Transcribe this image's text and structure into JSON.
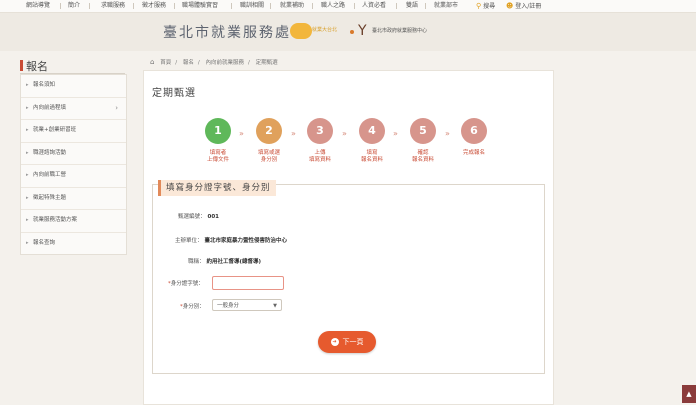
{
  "topnav": {
    "items": [
      "網站導覽",
      "簡介",
      "求職服務",
      "徵才服務",
      "職場體驗實習",
      "職訓相關",
      "就業補助",
      "職人之路",
      "人資必看",
      "雙語",
      "就業部市"
    ],
    "search_label": "搜尋",
    "login_label": "登入/註冊"
  },
  "banner": {
    "title": "臺北市就業服務處",
    "logo1_text": "就業大台北",
    "logo2_text": "臺北市政府就業服務中心"
  },
  "sidebar": {
    "heading": "報名",
    "items": [
      "報名須知",
      "內向前過程填",
      "就業+創業研習班",
      "職涯諮詢活動",
      "內向前職工營",
      "徵起特殊主題",
      "就業服務活動方案",
      "報名查詢"
    ]
  },
  "breadcrumb": [
    "首頁",
    "報名",
    "內向前就業服務",
    "定期甄選"
  ],
  "page": {
    "title": "定期甄選"
  },
  "steps": [
    {
      "num": "1",
      "label": "填寫者\n上傳文件",
      "color": "#5fb85a"
    },
    {
      "num": "2",
      "label": "填寫或選\n身分別",
      "color": "#e0a15c"
    },
    {
      "num": "3",
      "label": "上傳\n填寫資料",
      "color": "#d7958c"
    },
    {
      "num": "4",
      "label": "填寫\n報名資料",
      "color": "#d7958c"
    },
    {
      "num": "5",
      "label": "確認\n報名資料",
      "color": "#d7958c"
    },
    {
      "num": "6",
      "label": "完成報名",
      "color": "#d7958c"
    }
  ],
  "form": {
    "section_title": "填寫身分證字號、身分別",
    "rows": [
      {
        "label": "甄選編號：",
        "value": "001"
      },
      {
        "label": "主辦單位：",
        "value": "臺北市家庭暴力暨性侵害防治中心"
      },
      {
        "label": "職稱：",
        "value": "約用社工督導(總督導)"
      }
    ],
    "id_label": "身分證字號：",
    "id_value": "",
    "identity_label": "身分別：",
    "identity_selected": "一般身分",
    "next_label": "下一頁"
  }
}
